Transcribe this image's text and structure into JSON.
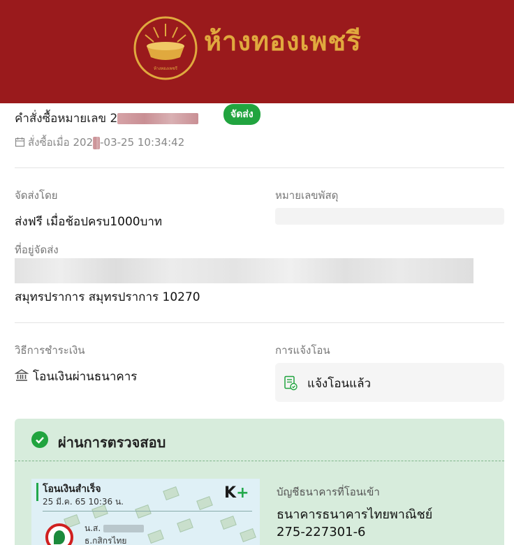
{
  "header": {
    "brand_name": "ห้างทองเพชรี",
    "logo_caption": "ห้างทองเพชรี",
    "background_color": "#9a1a1c",
    "accent_color": "#e0a93e"
  },
  "order": {
    "number_label": "คำสั่งซื้อหมายเลข",
    "number_prefix": "2",
    "status_badge": "จัดส่ง",
    "status_color": "#21a43f",
    "date_label": "สั่งซื้อเมื่อ",
    "date_part1": "202",
    "date_part2": "-03-25 10:34:42"
  },
  "shipping": {
    "method_label": "จัดส่งโดย",
    "method_value": "ส่งฟรี เมื่อช้อปครบ1000บาท",
    "tracking_label": "หมายเลขพัสดุ",
    "address_label": "ที่อยู่จัดส่ง",
    "address_line2": "สมุทรปราการ สมุทรปราการ 10270"
  },
  "payment": {
    "method_label": "วิธีการชำระเงิน",
    "method_value": "โอนเงินผ่านธนาคาร",
    "method_icon": "bank-icon",
    "notify_label": "การแจ้งโอน",
    "notify_value": "แจ้งโอนแล้ว",
    "notify_icon": "document-check-icon"
  },
  "verification": {
    "title": "ผ่านการตรวจสอบ",
    "slip": {
      "status": "โอนเงินสำเร็จ",
      "datetime": "25 มี.ค. 65  10:36 น.",
      "app_logo_k": "K",
      "app_logo_plus": "+",
      "sender_prefix": "น.ส.",
      "sender_bank": "ธ.กสิกรไทย"
    },
    "account_label": "บัญชีธนาคารที่โอนเข้า",
    "bank_name": "ธนาคารธนาคารไทยพาณิชย์",
    "account_number": "275-227301-6"
  }
}
